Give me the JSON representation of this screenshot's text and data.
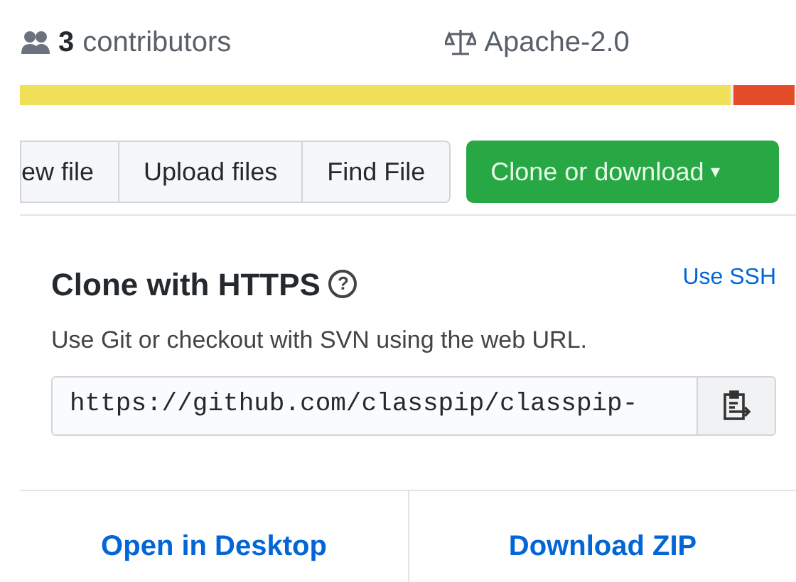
{
  "summary": {
    "contributors_count": "3",
    "contributors_label": "contributors",
    "license": "Apache-2.0"
  },
  "languages": [
    {
      "color": "#f1e05a",
      "level": 0.915
    },
    {
      "color": "#e34c26",
      "level": 0.08
    }
  ],
  "file_buttons": [
    "ew file",
    "Upload files",
    "Find File"
  ],
  "clone_button": {
    "label": "Clone or download",
    "caret": "▾"
  },
  "clone_panel": {
    "title": "Clone with HTTPS",
    "help": "?",
    "switch_link": "Use SSH",
    "description": "Use Git or checkout with SVN using the web URL.",
    "url": "https://github.com/classpip/classpip-"
  },
  "actions": [
    "Open in Desktop",
    "Download ZIP"
  ]
}
